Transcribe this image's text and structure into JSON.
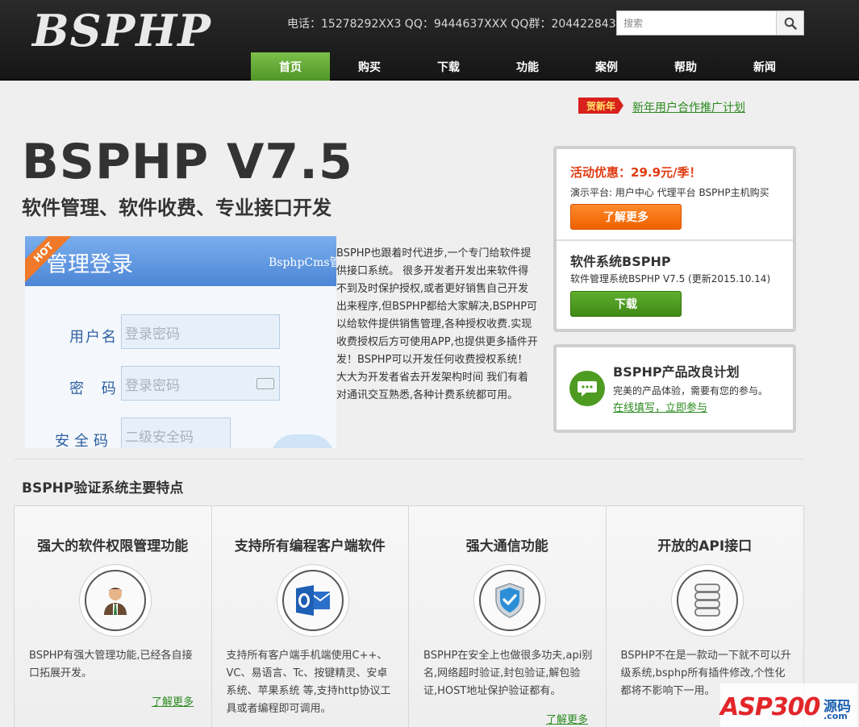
{
  "header": {
    "logo": "BSPHP",
    "contact": "电话：15278292XX3 QQ：9444637XXX QQ群：204422843",
    "search_placeholder": "搜索",
    "nav": [
      "首页",
      "购买",
      "下载",
      "功能",
      "案例",
      "帮助",
      "新闻"
    ],
    "nav_active": 0
  },
  "promo_bar": {
    "badge": "贺新年",
    "link": "新年用户合作推广计划"
  },
  "hero": {
    "title": "BSPHP V7.5",
    "subtitle": "软件管理、软件收费、专业接口开发",
    "description": "BSPHP也跟着时代进步,一个专门给软件提供接口系统。 很多开发者开发出来软件得不到及时保护授权,或者更好销售自己开发出来程序,但BSPHP都给大家解决,BSPHP可以给软件提供销售管理,各种授权收费.实现收费授权后方可使用APP,也提供更多插件开发！BSPHP可以开发任何收费授权系统！大大为开发者省去开发架构时间 我们有着对通讯交互熟悉,各种计费系统都可用。"
  },
  "login_preview": {
    "hot": "HOT",
    "title": "管理登录",
    "brand": "BsphpCms管理",
    "username_label": "用户名",
    "username_placeholder": "登录密码",
    "password_label": "密  码",
    "password_placeholder": "登录密码",
    "security_label": "安全码",
    "security_placeholder": "二级安全码"
  },
  "side_box": {
    "promo_title": "活动优惠：29.9元/季！",
    "promo_text": "演示平台: 用户中心 代理平台 BSPHP主机购买",
    "promo_button": "了解更多",
    "system_title": "软件系统BSPHP",
    "system_text": "软件管理系统BSPHP V7.5 (更新2015.10.14)",
    "system_button": "下载"
  },
  "plan_box": {
    "title": "BSPHP产品改良计划",
    "text": "完美的产品体验，需要有您的参与。",
    "link": "在线填写，立即参与"
  },
  "features_section": {
    "title": "BSPHP验证系统主要特点",
    "items": [
      {
        "title": "强大的软件权限管理功能",
        "icon": "user-icon",
        "text": "BSPHP有强大管理功能,已经各自接口拓展开发。",
        "more": "了解更多"
      },
      {
        "title": "支持所有编程客户端软件",
        "icon": "outlook-icon",
        "text": "支持所有客户端手机端使用C++、VC、易语言、Tc、按键精灵、安卓系统、苹果系统 等,支持http协议工具或者编程即可调用。",
        "more": ""
      },
      {
        "title": "强大通信功能",
        "icon": "shield-check-icon",
        "text": "BSPHP在安全上也做很多功夫,api别名,网络超时验证,封包验证,解包验证,HOST地址保护验证都有。",
        "more": "了解更多"
      },
      {
        "title": "开放的API接口",
        "icon": "database-icon",
        "text": "BSPHP不在是一款动一下就不可以升级系统,bsphp所有插件修改,个性化都将不影响下一用。",
        "more": ""
      }
    ]
  },
  "watermark": {
    "brand": "ASP300",
    "label": "源码",
    "domain": ".com"
  },
  "colors": {
    "nav_active": "#5ea82f",
    "promo_red": "#e03c12",
    "link_green": "#2a8a1e",
    "button_orange": "#f57a1e",
    "button_green": "#4f9b22"
  }
}
